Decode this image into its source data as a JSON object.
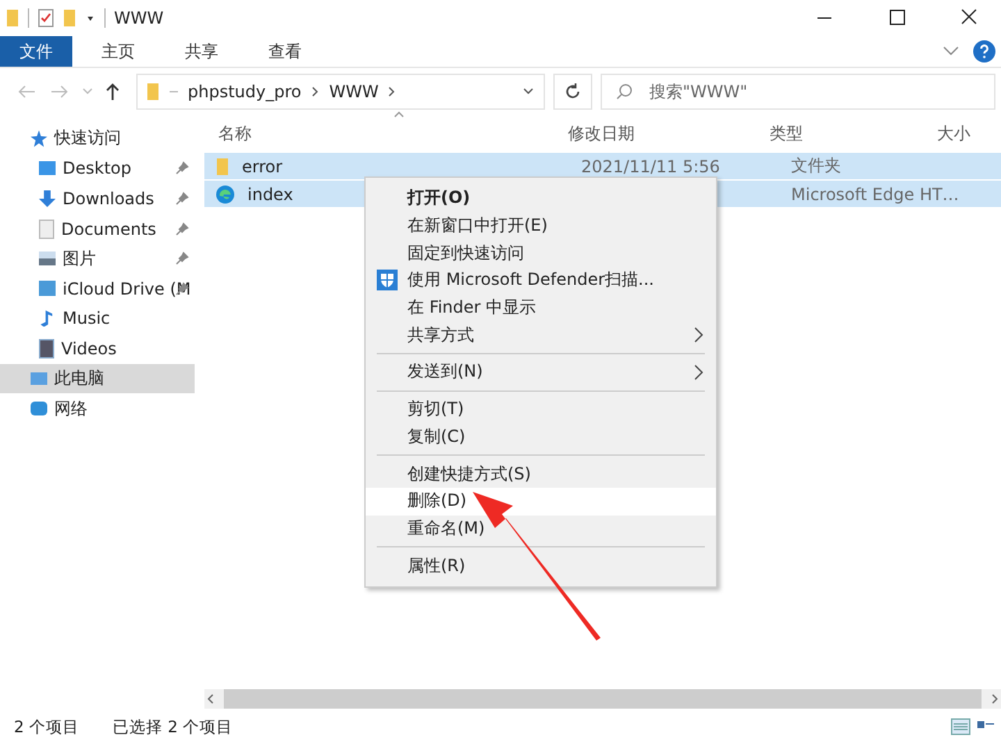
{
  "window": {
    "title": "WWW"
  },
  "ribbon_tabs": [
    {
      "label": "文件",
      "selected": true
    },
    {
      "label": "主页",
      "selected": false
    },
    {
      "label": "共享",
      "selected": false
    },
    {
      "label": "查看",
      "selected": false
    }
  ],
  "address": {
    "breadcrumb": [
      "phpstudy_pro",
      "WWW"
    ]
  },
  "search": {
    "placeholder": "搜索\"WWW\""
  },
  "sidebar": [
    {
      "label": "快速访问",
      "kind": "star",
      "selected": false,
      "children": [
        {
          "label": "Desktop",
          "kind": "desktop",
          "pinned": true
        },
        {
          "label": "Downloads",
          "kind": "download",
          "pinned": true
        },
        {
          "label": "Documents",
          "kind": "document",
          "pinned": true
        },
        {
          "label": "图片",
          "kind": "pictures",
          "pinned": true
        },
        {
          "label": "iCloud Drive (M",
          "kind": "cloudfolder",
          "pinned": true
        },
        {
          "label": "Music",
          "kind": "music",
          "pinned": false
        },
        {
          "label": "Videos",
          "kind": "video",
          "pinned": false
        }
      ]
    },
    {
      "label": "此电脑",
      "kind": "pc",
      "selected": true
    },
    {
      "label": "网络",
      "kind": "network",
      "selected": false
    }
  ],
  "columns": [
    "名称",
    "修改日期",
    "类型",
    "大小"
  ],
  "files": [
    {
      "name": "error",
      "kind": "folder",
      "date": "2021/11/11 5:56",
      "type": "文件夹",
      "selected": true
    },
    {
      "name": "index",
      "kind": "edge",
      "type": "Microsoft Edge HT…",
      "selected": true
    }
  ],
  "context_menu": [
    [
      {
        "label": "打开(O)",
        "kind": "default",
        "selected": false
      },
      {
        "label": "在新窗口中打开(E)",
        "kind": "plain",
        "selected": false
      },
      {
        "label": "固定到快速访问",
        "kind": "plain",
        "selected": false
      },
      {
        "label": "使用 Microsoft Defender扫描...",
        "kind": "scan",
        "selected": false
      },
      {
        "label": "在 Finder 中显示",
        "kind": "plain",
        "selected": false
      },
      {
        "label": "共享方式",
        "kind": "submenu",
        "selected": false
      }
    ],
    [
      {
        "label": "发送到(N)",
        "kind": "submenu",
        "selected": false
      }
    ],
    [
      {
        "label": "剪切(T)",
        "kind": "plain",
        "selected": false
      },
      {
        "label": "复制(C)",
        "kind": "plain",
        "selected": false
      }
    ],
    [
      {
        "label": "创建快捷方式(S)",
        "kind": "plain",
        "selected": false
      },
      {
        "label": "删除(D)",
        "kind": "plain",
        "selected": true
      },
      {
        "label": "重命名(M)",
        "kind": "plain",
        "selected": false
      }
    ],
    [
      {
        "label": "属性(R)",
        "kind": "plain",
        "selected": false
      }
    ]
  ],
  "status_bar": {
    "count": "2 个项目",
    "selection": "已选择 2 个项目"
  }
}
